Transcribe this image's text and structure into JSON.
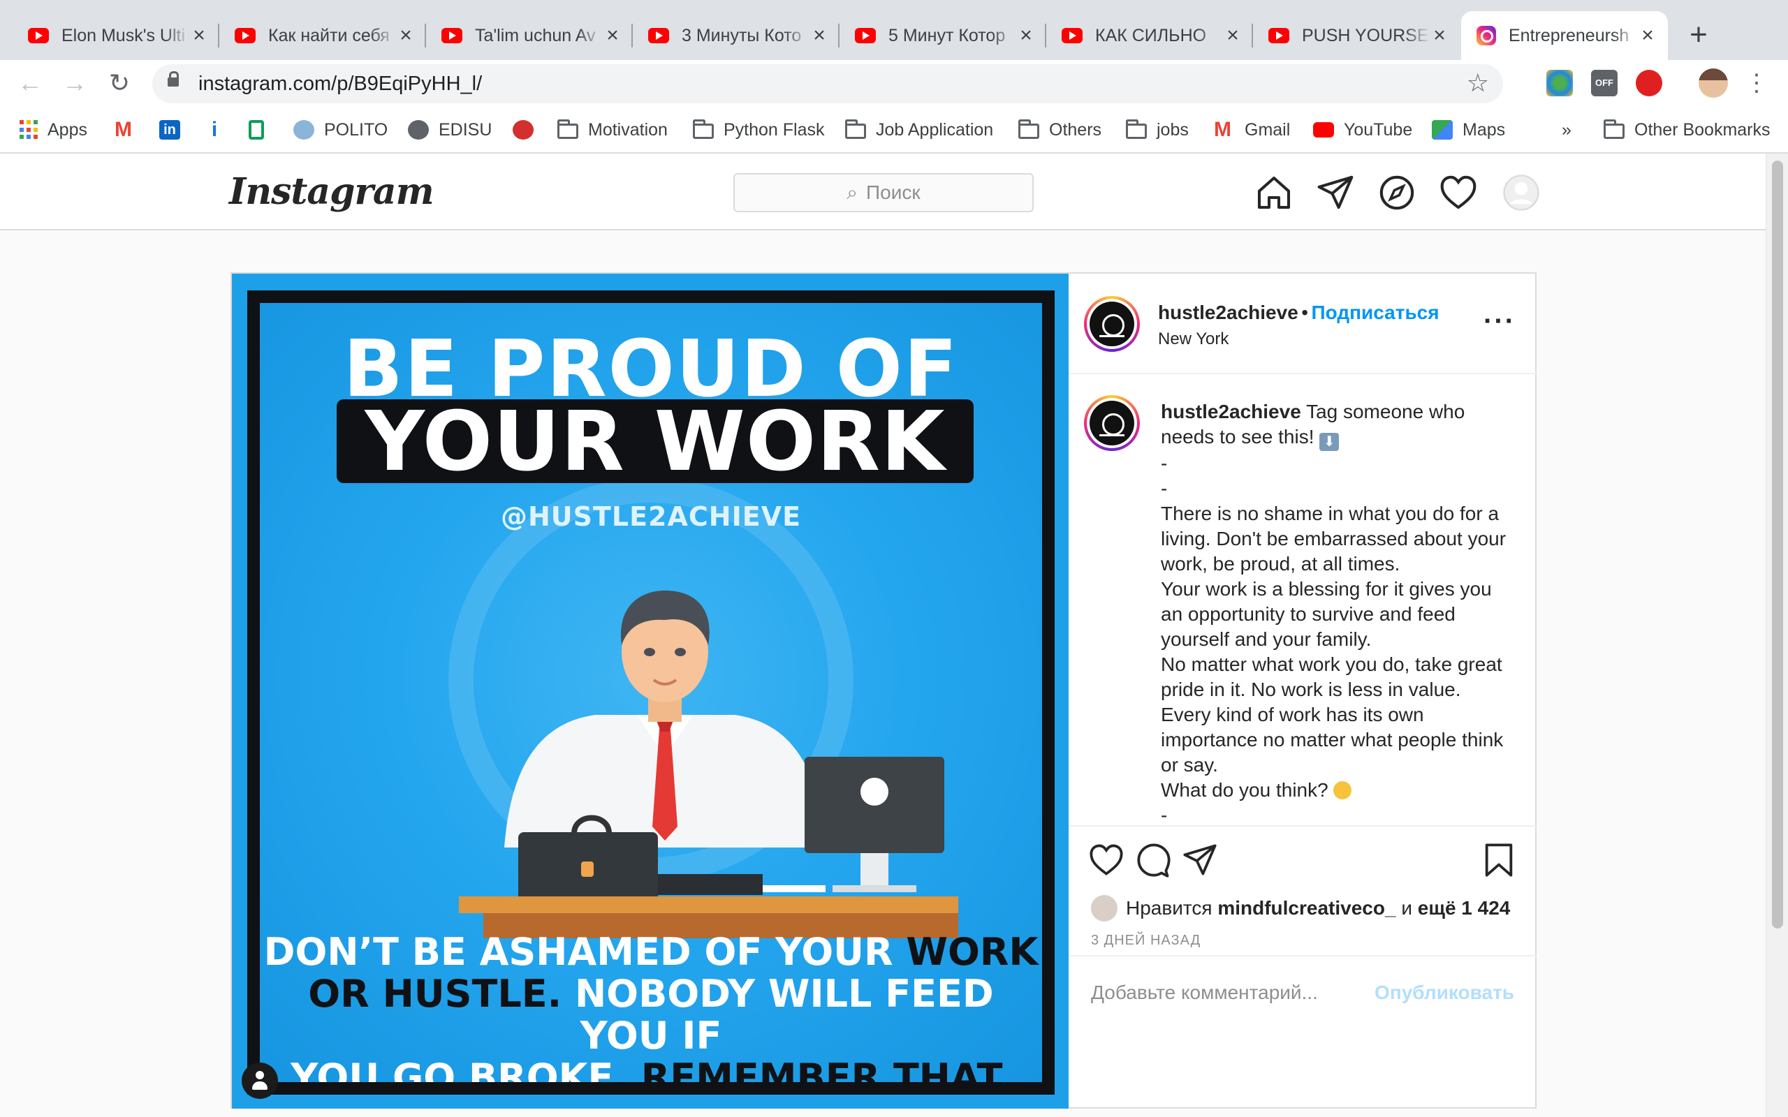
{
  "browser": {
    "tabs": [
      {
        "title": "Elon Musk's Ulti",
        "icon": "youtube-icon"
      },
      {
        "title": "Как найти себя",
        "icon": "youtube-icon"
      },
      {
        "title": "Ta'lim uchun Av",
        "icon": "youtube-icon"
      },
      {
        "title": "3 Минуты Кото",
        "icon": "youtube-icon"
      },
      {
        "title": "5 Минут Котор",
        "icon": "youtube-icon"
      },
      {
        "title": "КАК СИЛЬНО",
        "icon": "youtube-icon"
      },
      {
        "title": "PUSH YOURSE",
        "icon": "youtube-icon"
      },
      {
        "title": "Entrepreneursh",
        "icon": "instagram-icon",
        "active": true
      }
    ],
    "url": "instagram.com/p/B9EqiPyHH_l/",
    "bookmarks": [
      {
        "label": "Apps",
        "icon": "apps-grid-icon"
      },
      {
        "label": "",
        "icon": "gmail-icon"
      },
      {
        "label": "",
        "icon": "linkedin-icon"
      },
      {
        "label": "",
        "icon": "info-icon"
      },
      {
        "label": "",
        "icon": "green-doc-icon"
      },
      {
        "label": "POLITO",
        "icon": "polito-icon"
      },
      {
        "label": "EDISU",
        "icon": "globe-icon"
      },
      {
        "label": "",
        "icon": "anki-icon"
      },
      {
        "label": "Motivation",
        "icon": "folder-icon"
      },
      {
        "label": "Python Flask",
        "icon": "folder-icon"
      },
      {
        "label": "Job Application",
        "icon": "folder-icon"
      },
      {
        "label": "Others",
        "icon": "folder-icon"
      },
      {
        "label": "jobs",
        "icon": "folder-icon"
      },
      {
        "label": "Gmail",
        "icon": "gmail-icon"
      },
      {
        "label": "YouTube",
        "icon": "youtube-icon"
      },
      {
        "label": "Maps",
        "icon": "maps-icon"
      }
    ],
    "overflow": "»",
    "other_bookmarks": "Other Bookmarks"
  },
  "instagram": {
    "logo": "Instagram",
    "search_placeholder": "Поиск"
  },
  "image": {
    "line1": "BE PROUD OF",
    "line2": "YOUR WORK",
    "handle": "@HUSTLE2ACHIEVE",
    "bottom_a": "DON’T BE ASHAMED OF YOUR",
    "bottom_b": "WORK",
    "bottom_c": "OR HUSTLE.",
    "bottom_d": "NOBODY WILL FEED YOU IF",
    "bottom_e": "YOU GO BROKE.",
    "bottom_f": "REMEMBER THAT."
  },
  "post": {
    "username": "hustle2achieve",
    "dot": "•",
    "follow": "Подписаться",
    "location": "New York",
    "caption_user": "hustle2achieve",
    "caption_lines": [
      "Tag someone who needs to see this!",
      "-",
      "-",
      "There is no shame in what you do for a living. Don't be embarrassed about your work, be proud, at all times.",
      "Your work is a blessing for it gives you an opportunity to survive and feed yourself and your family.",
      "No matter what work you do, take great pride in it. No work is less in value. Every kind of work has its own importance no matter what people think or say.",
      "What do you think?",
      "-",
      "-"
    ],
    "likes_prefix": "Нравится",
    "likes_user": "mindfulcreativeco_",
    "likes_mid": "и",
    "likes_count": "ещё 1 424",
    "time_ago": "3 ДНЕЙ НАЗАД",
    "comment_placeholder": "Добавьте комментарий...",
    "publish": "Опубликовать"
  },
  "colors": {
    "ig_blue": "#0095f6",
    "image_blue": "#1ea0e8",
    "tab_bg": "#dee1e6"
  }
}
